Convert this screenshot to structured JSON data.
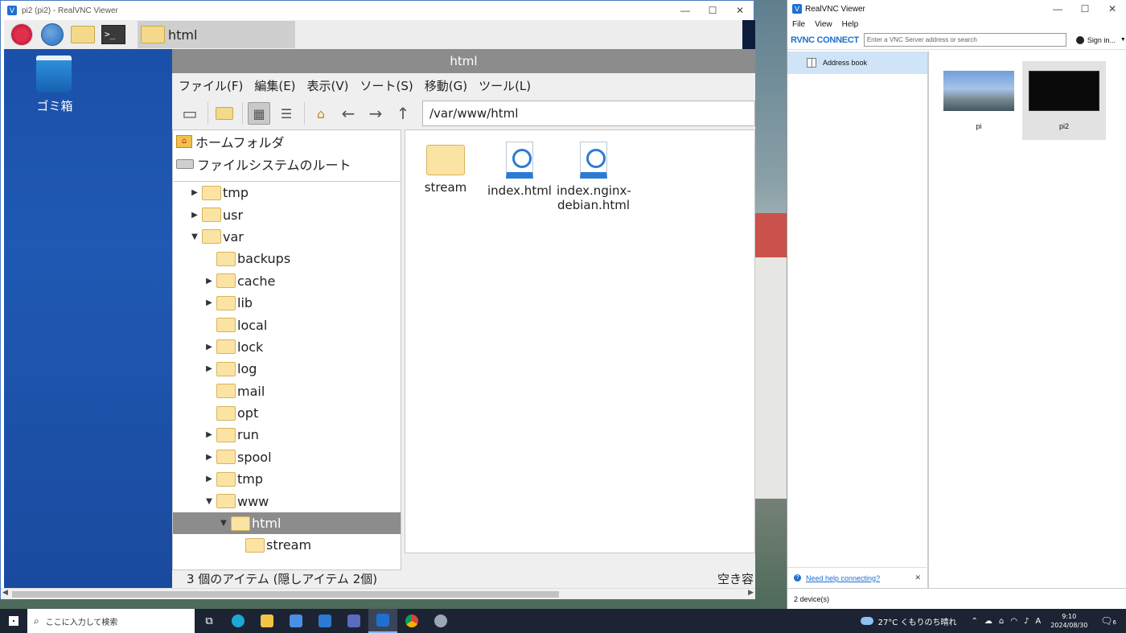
{
  "vnc_window": {
    "title": "pi2 (pi2) - RealVNC Viewer",
    "app_icon": "realvnc-icon",
    "controls": {
      "minimize": "—",
      "maximize": "☐",
      "close": "✕"
    }
  },
  "remote_taskbar": {
    "active_task_label": "html"
  },
  "remote_desktop": {
    "trash_label": "ゴミ箱"
  },
  "file_manager": {
    "title": "html",
    "menu": [
      "ファイル(F)",
      "編集(E)",
      "表示(V)",
      "ソート(S)",
      "移動(G)",
      "ツール(L)"
    ],
    "path": "/var/www/html",
    "places": {
      "home": "ホームフォルダ",
      "root": "ファイルシステムのルート"
    },
    "tree": [
      {
        "label": "tmp",
        "arrow": "▶",
        "depth": 0
      },
      {
        "label": "usr",
        "arrow": "▶",
        "depth": 0
      },
      {
        "label": "var",
        "arrow": "▼",
        "depth": 0
      },
      {
        "label": "backups",
        "arrow": "",
        "depth": 1
      },
      {
        "label": "cache",
        "arrow": "▶",
        "depth": 1
      },
      {
        "label": "lib",
        "arrow": "▶",
        "depth": 1
      },
      {
        "label": "local",
        "arrow": "",
        "depth": 1
      },
      {
        "label": "lock",
        "arrow": "▶",
        "depth": 1
      },
      {
        "label": "log",
        "arrow": "▶",
        "depth": 1
      },
      {
        "label": "mail",
        "arrow": "",
        "depth": 1
      },
      {
        "label": "opt",
        "arrow": "",
        "depth": 1
      },
      {
        "label": "run",
        "arrow": "▶",
        "depth": 1
      },
      {
        "label": "spool",
        "arrow": "▶",
        "depth": 1
      },
      {
        "label": "tmp",
        "arrow": "▶",
        "depth": 1
      },
      {
        "label": "www",
        "arrow": "▼",
        "depth": 1
      },
      {
        "label": "html",
        "arrow": "▼",
        "depth": 2,
        "selected": true
      },
      {
        "label": "stream",
        "arrow": "",
        "depth": 3
      }
    ],
    "items": [
      {
        "label": "stream",
        "kind": "folder"
      },
      {
        "label": "index.html",
        "kind": "html"
      },
      {
        "label": "index.nginx-debian.html",
        "kind": "html"
      }
    ],
    "item_labels": {
      "stream": "stream",
      "index": "index.html",
      "nginx_line1": "index.nginx-",
      "nginx_line2": "debian.html"
    },
    "status_left": "3 個のアイテム (隠しアイテム 2個)",
    "status_right": "空き容"
  },
  "viewer": {
    "title": "RealVNC Viewer",
    "menu": {
      "file": "File",
      "view": "View",
      "help": "Help"
    },
    "logo": "RVNC CONNECT",
    "search_placeholder": "Enter a VNC Server address or search",
    "sign_in": "Sign in...",
    "address_book": "Address book",
    "devices": [
      {
        "name": "pi"
      },
      {
        "name": "pi2",
        "selected": true
      }
    ],
    "help_link": "Need help connecting?",
    "status": "2 device(s)"
  },
  "win_taskbar": {
    "search_placeholder": "ここに入力して検索",
    "weather": "27°C くもりのち晴れ",
    "time": "9:10",
    "date": "2024/08/30",
    "notification_count": "6",
    "ime": "A"
  }
}
